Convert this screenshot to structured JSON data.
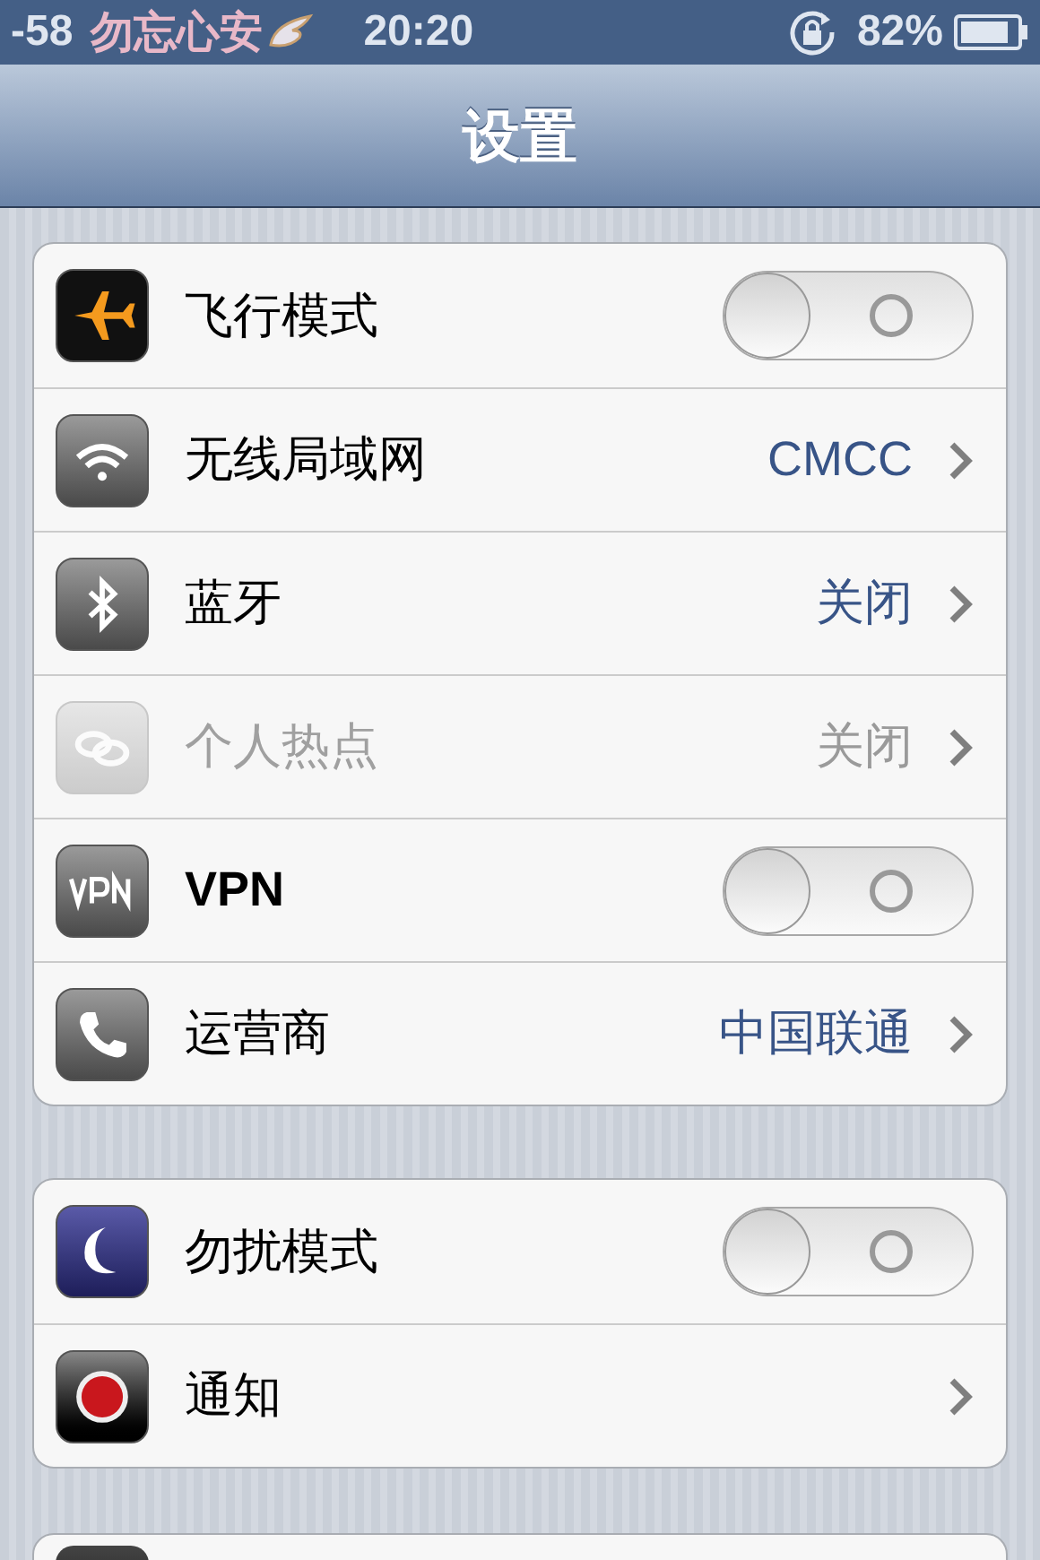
{
  "status_bar": {
    "signal": "-58",
    "carrier": "勿忘心安",
    "time": "20:20",
    "battery": "82%"
  },
  "nav": {
    "title": "设置"
  },
  "groups": [
    {
      "rows": [
        {
          "label": "飞行模式",
          "kind": "toggle",
          "on": false,
          "disabled": false
        },
        {
          "label": "无线局域网",
          "kind": "link",
          "value": "CMCC",
          "disabled": false
        },
        {
          "label": "蓝牙",
          "kind": "link",
          "value": "关闭",
          "disabled": false
        },
        {
          "label": "个人热点",
          "kind": "link",
          "value": "关闭",
          "disabled": true
        },
        {
          "label": "VPN",
          "kind": "toggle",
          "on": false,
          "disabled": false
        },
        {
          "label": "运营商",
          "kind": "link",
          "value": "中国联通",
          "disabled": false
        }
      ]
    },
    {
      "rows": [
        {
          "label": "勿扰模式",
          "kind": "toggle",
          "on": false,
          "disabled": false
        },
        {
          "label": "通知",
          "kind": "link",
          "disabled": false
        }
      ]
    }
  ]
}
